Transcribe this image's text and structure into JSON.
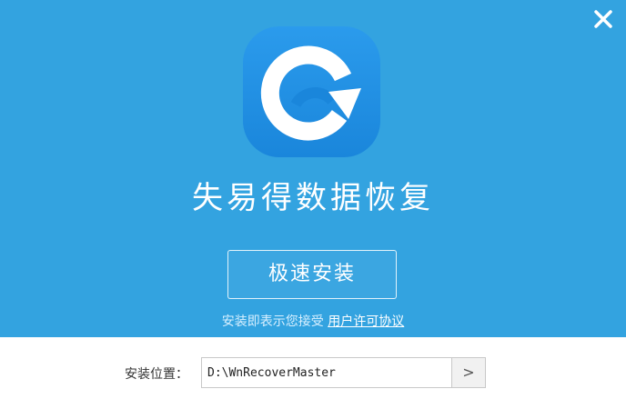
{
  "app": {
    "title": "失易得数据恢复"
  },
  "install": {
    "button_label": "极速安装",
    "agreement_prefix": "安装即表示您接受",
    "agreement_link": "用户许可协议"
  },
  "location": {
    "label": "安装位置：",
    "path": "D:\\WnRecoverMaster",
    "browse_label": ">"
  },
  "icons": {
    "close": "close-icon",
    "logo": "app-logo-icon"
  },
  "colors": {
    "header_bg": "#33a3e0",
    "logo_bg": "#1c8fe0",
    "text_on_blue": "#ffffff"
  }
}
